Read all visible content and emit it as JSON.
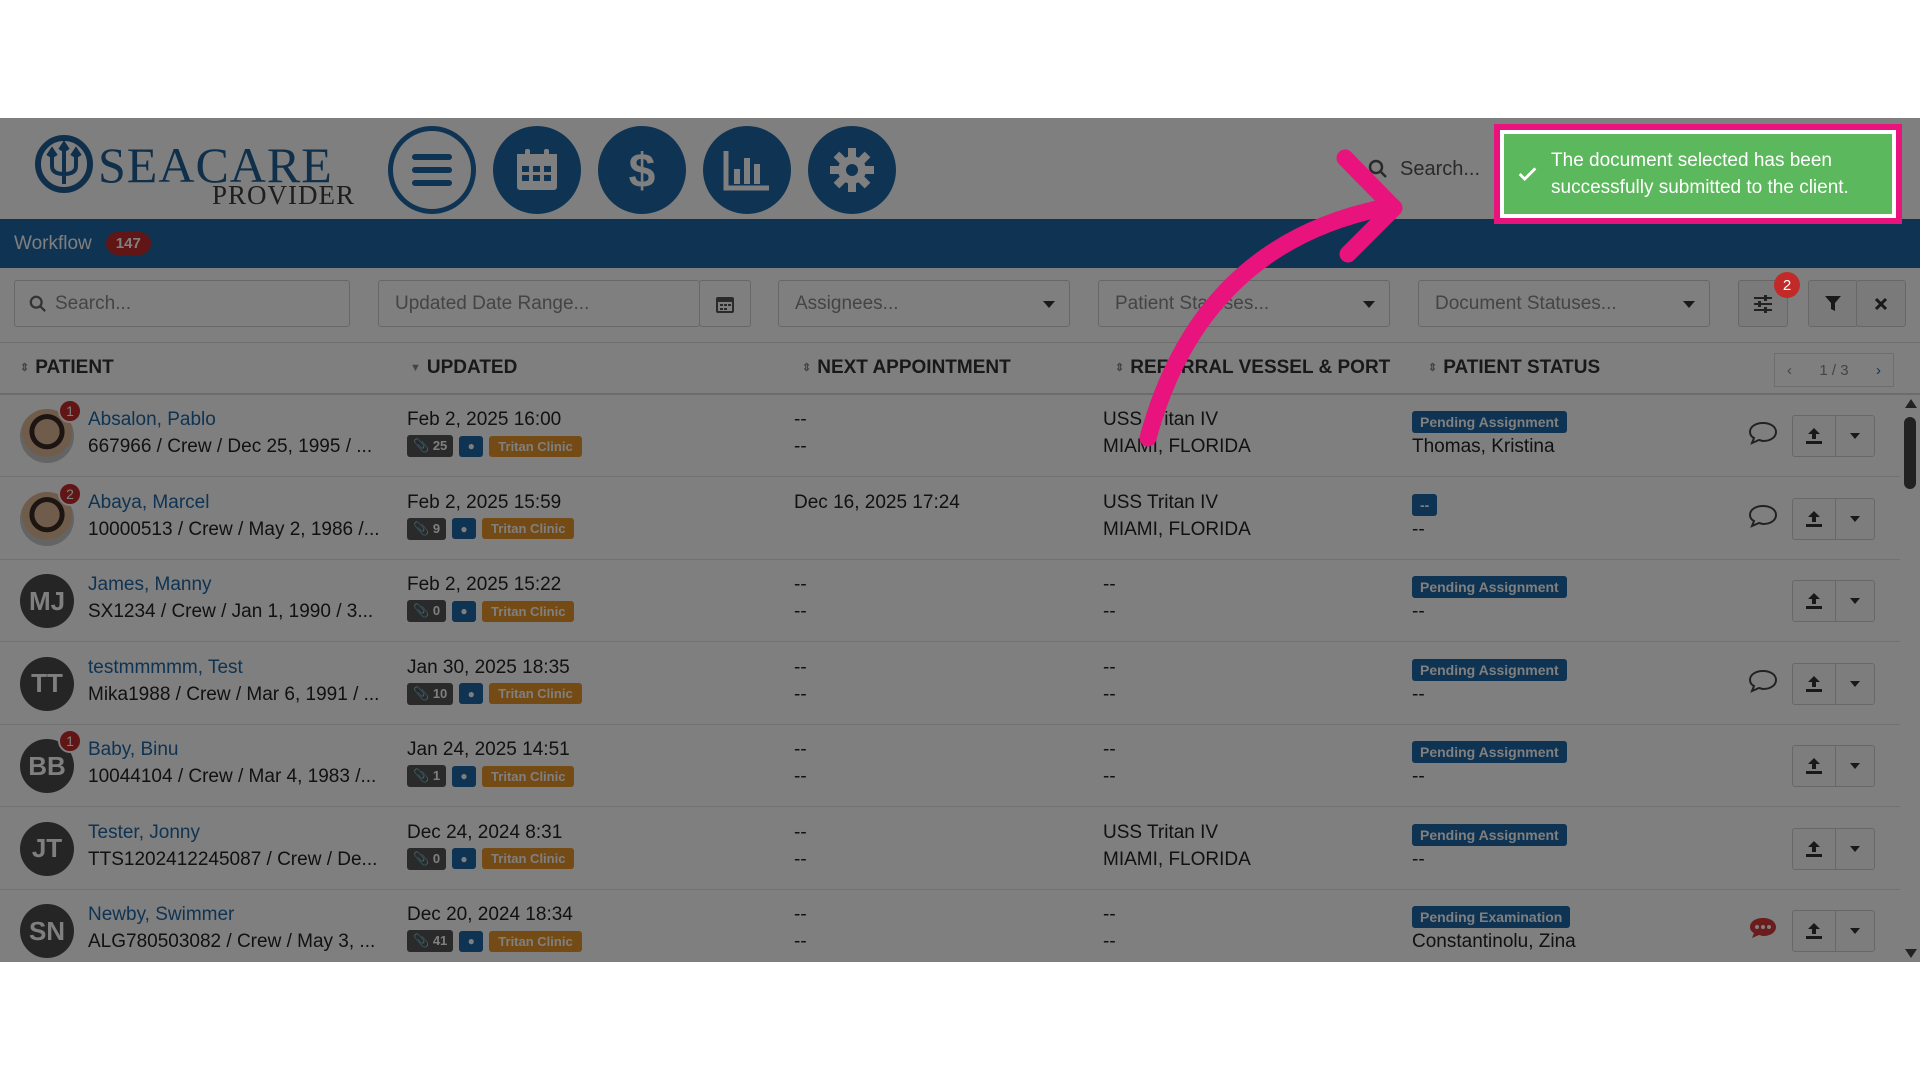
{
  "app": {
    "logo_word": "SEACARE",
    "logo_sub": "PROVIDER",
    "nav": [
      "menu-icon",
      "calendar-icon",
      "dollar-icon",
      "bar-chart-icon",
      "gear-icon"
    ],
    "top_search_placeholder": "Search...",
    "accent": "#1e67a4"
  },
  "workflow": {
    "label": "Workflow",
    "count": "147"
  },
  "filters": {
    "search_placeholder": "Search...",
    "date_placeholder": "Updated Date Range...",
    "assignees_placeholder": "Assignees...",
    "patient_status_placeholder": "Patient Statuses...",
    "document_status_placeholder": "Document Statuses...",
    "active_filter_count": "2"
  },
  "table": {
    "headers": [
      "PATIENT",
      "UPDATED",
      "NEXT APPOINTMENT",
      "REFERRAL VESSEL & PORT",
      "PATIENT STATUS"
    ],
    "pager": "1 / 3",
    "rows": [
      {
        "initials": "",
        "photo": true,
        "badge": "1",
        "name": "Absalon, Pablo",
        "info": "667966 / Crew / Dec 25, 1995 / ...",
        "updated": "Feb 2, 2025 16:00",
        "docs": "25",
        "clinic": "Tritan Clinic",
        "appt1": "--",
        "appt2": "--",
        "vessel": "USS Tritan IV",
        "port": "MIAMI, FLORIDA",
        "status": "Pending Assignment",
        "status_sub": "Thomas, Kristina",
        "chat": "outline"
      },
      {
        "initials": "",
        "photo": true,
        "badge": "2",
        "name": "Abaya, Marcel",
        "info": "10000513 / Crew / May 2, 1986 /...",
        "updated": "Feb 2, 2025 15:59",
        "docs": "9",
        "clinic": "Tritan Clinic",
        "appt1": "Dec 16, 2025 17:24",
        "appt2": "",
        "vessel": "USS Tritan IV",
        "port": "MIAMI, FLORIDA",
        "status": "--",
        "status_sub": "--",
        "chat": "outline"
      },
      {
        "initials": "MJ",
        "photo": false,
        "badge": "",
        "name": "James, Manny",
        "info": "SX1234 / Crew / Jan 1, 1990 / 3...",
        "updated": "Feb 2, 2025 15:22",
        "docs": "0",
        "clinic": "Tritan Clinic",
        "appt1": "--",
        "appt2": "--",
        "vessel": "--",
        "port": "--",
        "status": "Pending Assignment",
        "status_sub": "--",
        "chat": ""
      },
      {
        "initials": "TT",
        "photo": false,
        "badge": "",
        "name": "testmmmmm, Test",
        "info": "Mika1988 / Crew / Mar 6, 1991 / ...",
        "updated": "Jan 30, 2025 18:35",
        "docs": "10",
        "clinic": "Tritan Clinic",
        "appt1": "--",
        "appt2": "--",
        "vessel": "--",
        "port": "--",
        "status": "Pending Assignment",
        "status_sub": "--",
        "chat": "outline"
      },
      {
        "initials": "BB",
        "photo": false,
        "badge": "1",
        "name": "Baby, Binu",
        "info": "10044104 / Crew / Mar 4, 1983 /...",
        "updated": "Jan 24, 2025 14:51",
        "docs": "1",
        "clinic": "Tritan Clinic",
        "appt1": "--",
        "appt2": "--",
        "vessel": "--",
        "port": "--",
        "status": "Pending Assignment",
        "status_sub": "--",
        "chat": ""
      },
      {
        "initials": "JT",
        "photo": false,
        "badge": "",
        "name": "Tester, Jonny",
        "info": "TTS1202412245087 / Crew / De...",
        "updated": "Dec 24, 2024 8:31",
        "docs": "0",
        "clinic": "Tritan Clinic",
        "appt1": "--",
        "appt2": "--",
        "vessel": "USS Tritan IV",
        "port": "MIAMI, FLORIDA",
        "status": "Pending Assignment",
        "status_sub": "--",
        "chat": ""
      },
      {
        "initials": "SN",
        "photo": false,
        "badge": "",
        "name": "Newby, Swimmer",
        "info": "ALG780503082 / Crew / May 3, ...",
        "updated": "Dec 20, 2024 18:34",
        "docs": "41",
        "clinic": "Tritan Clinic",
        "appt1": "--",
        "appt2": "--",
        "vessel": "--",
        "port": "--",
        "status": "Pending Examination",
        "status_sub": "Constantinolu, Zina",
        "chat": "filled"
      }
    ]
  },
  "toast": {
    "message": "The document selected has been successfully submitted to the client.",
    "color": "#5cb85c",
    "highlight": "#e8137c"
  }
}
